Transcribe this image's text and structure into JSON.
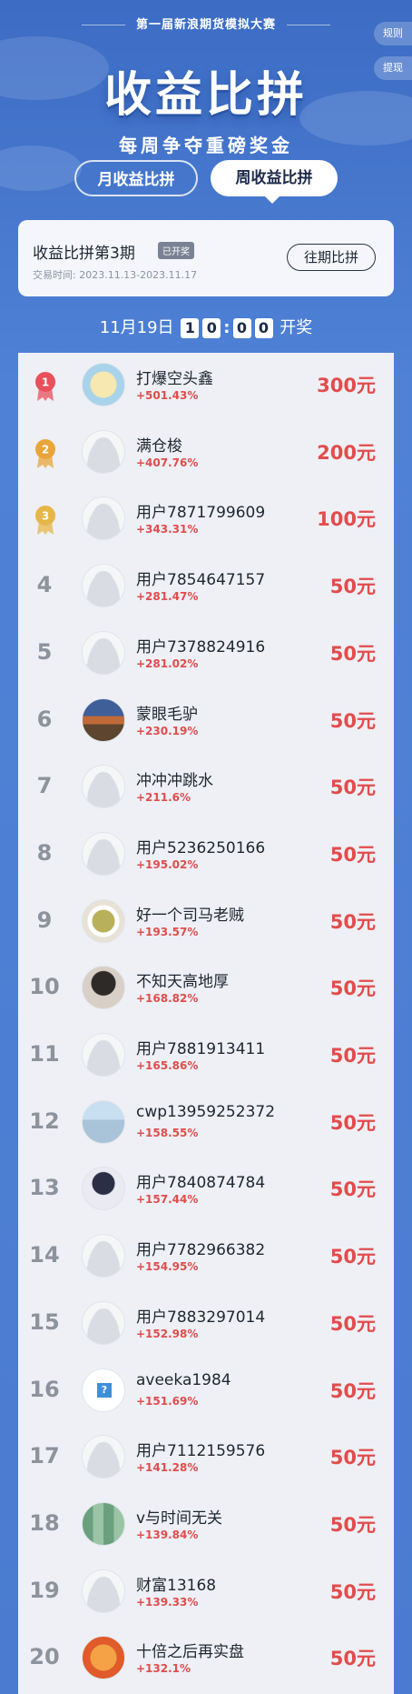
{
  "header": {
    "competition": "第一届新浪期货模拟大赛",
    "rules": "规则",
    "withdraw": "提现",
    "title": "收益比拼",
    "subtitle": "每周争夺重磅奖金"
  },
  "tabs": {
    "month": "月收益比拼",
    "week": "周收益比拼"
  },
  "period": {
    "title": "收益比拼第3期",
    "badge": "已开奖",
    "date": "交易时间: 2023.11.13-2023.11.17",
    "history_button": "往期比拼"
  },
  "countdown": {
    "date": "11月19日",
    "h1": "1",
    "h2": "0",
    "m1": "0",
    "m2": "0",
    "suffix": "开奖"
  },
  "colors": {
    "accent": "#e24c4c",
    "background": "#4a7bd0"
  },
  "ranking": [
    {
      "rank": "1",
      "name": "打爆空头鑫",
      "pct": "+501.43%",
      "prize": "300元"
    },
    {
      "rank": "2",
      "name": "满仓梭",
      "pct": "+407.76%",
      "prize": "200元"
    },
    {
      "rank": "3",
      "name": "用户7871799609",
      "pct": "+343.31%",
      "prize": "100元"
    },
    {
      "rank": "4",
      "name": "用户7854647157",
      "pct": "+281.47%",
      "prize": "50元"
    },
    {
      "rank": "5",
      "name": "用户7378824916",
      "pct": "+281.02%",
      "prize": "50元"
    },
    {
      "rank": "6",
      "name": "蒙眼毛驴",
      "pct": "+230.19%",
      "prize": "50元"
    },
    {
      "rank": "7",
      "name": "冲冲冲跳水",
      "pct": "+211.6%",
      "prize": "50元"
    },
    {
      "rank": "8",
      "name": "用户5236250166",
      "pct": "+195.02%",
      "prize": "50元"
    },
    {
      "rank": "9",
      "name": "好一个司马老贼",
      "pct": "+193.57%",
      "prize": "50元"
    },
    {
      "rank": "10",
      "name": "不知天高地厚",
      "pct": "+168.82%",
      "prize": "50元"
    },
    {
      "rank": "11",
      "name": "用户7881913411",
      "pct": "+165.86%",
      "prize": "50元"
    },
    {
      "rank": "12",
      "name": "cwp13959252372",
      "pct": "+158.55%",
      "prize": "50元"
    },
    {
      "rank": "13",
      "name": "用户7840874784",
      "pct": "+157.44%",
      "prize": "50元"
    },
    {
      "rank": "14",
      "name": "用户7782966382",
      "pct": "+154.95%",
      "prize": "50元"
    },
    {
      "rank": "15",
      "name": "用户7883297014",
      "pct": "+152.98%",
      "prize": "50元"
    },
    {
      "rank": "16",
      "name": "aveeka1984",
      "pct": "+151.69%",
      "prize": "50元"
    },
    {
      "rank": "17",
      "name": "用户7112159576",
      "pct": "+141.28%",
      "prize": "50元"
    },
    {
      "rank": "18",
      "name": "v与时间无关",
      "pct": "+139.84%",
      "prize": "50元"
    },
    {
      "rank": "19",
      "name": "财富13168",
      "pct": "+139.33%",
      "prize": "50元"
    },
    {
      "rank": "20",
      "name": "十倍之后再实盘",
      "pct": "+132.1%",
      "prize": "50元"
    }
  ]
}
